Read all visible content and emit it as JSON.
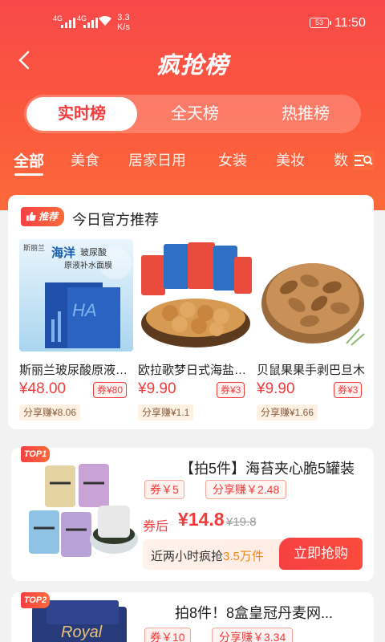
{
  "status_bar": {
    "signal1": "4G",
    "signal2": "4G",
    "speed_value": "3.3",
    "speed_unit": "K/s",
    "battery": "53",
    "time": "11:50"
  },
  "header": {
    "title": "疯抢榜"
  },
  "segments": [
    {
      "label": "实时榜",
      "active": true
    },
    {
      "label": "全天榜",
      "active": false
    },
    {
      "label": "热推榜",
      "active": false
    }
  ],
  "categories": [
    {
      "label": "全部",
      "active": true
    },
    {
      "label": "美食"
    },
    {
      "label": "居家日用"
    },
    {
      "label": "女装"
    },
    {
      "label": "美妆"
    },
    {
      "label": "数"
    }
  ],
  "recommend": {
    "badge": "推荐",
    "title": "今日官方推荐",
    "products": [
      {
        "name": "斯丽兰玻尿酸原液补水面膜",
        "price": "¥48.00",
        "coupon": "券¥80",
        "share": "分享赚¥8.06",
        "img_brand": "斯丽兰",
        "img_line1": "海洋",
        "img_line2": "玻尿酸",
        "img_line3": "原液补水面膜",
        "img_pack": "HA"
      },
      {
        "name": "欧拉歌梦日式海盐小圆饼干",
        "price": "¥9.90",
        "coupon": "券¥3",
        "share": "分享赚¥1.1"
      },
      {
        "name": "贝鼠果果手剥巴旦木",
        "price": "¥9.90",
        "coupon": "券¥3",
        "share": "分享赚¥1.66"
      }
    ]
  },
  "list": [
    {
      "rank_badge": "TOP1",
      "title": "【拍5件】海苔夹心脆5罐装",
      "coupon": "券￥5",
      "share": "分享赚￥2.48",
      "after_label": "券后",
      "after_price": "¥14.8",
      "orig_price": "¥19.8",
      "sold_prefix": "近两小时疯抢",
      "sold_count": "3.5万件",
      "buy_label": "立即抢购"
    },
    {
      "rank_badge": "TOP2",
      "title": "拍8件！8盒皇冠丹麦网...",
      "coupon": "券￥10",
      "share": "分享赚￥3.34",
      "img_brand": "Royal"
    }
  ],
  "colors": {
    "accent": "#f23c3c",
    "header_gradient_start": "#f8494a",
    "header_gradient_end": "#fb6a3a"
  }
}
